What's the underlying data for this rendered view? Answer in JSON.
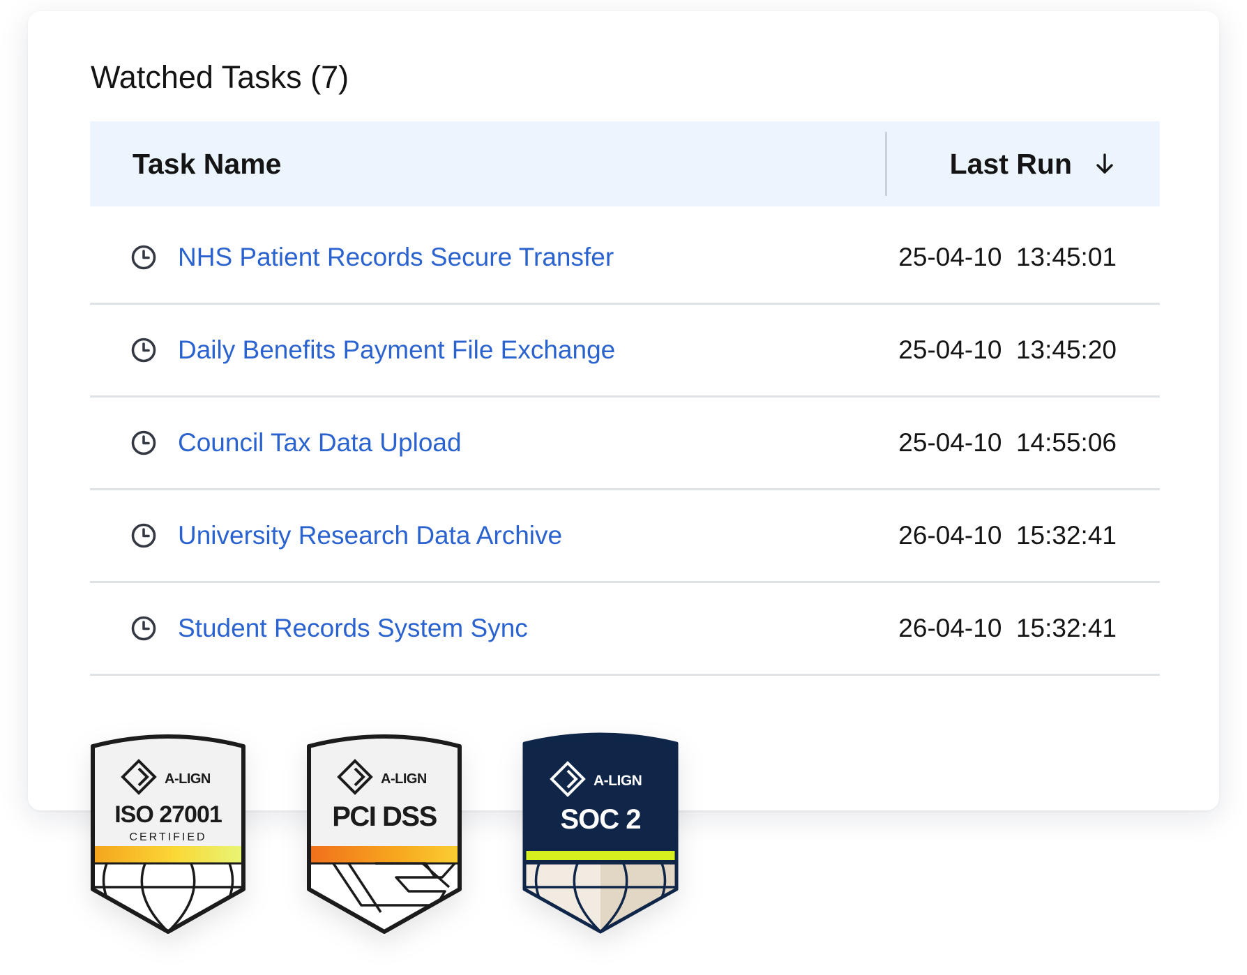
{
  "header": {
    "title": "Watched Tasks (7)"
  },
  "table": {
    "columns": {
      "task_name": "Task Name",
      "last_run": "Last Run"
    },
    "sort_icon": "arrow-down-icon",
    "row_icon": "clock-icon",
    "rows": [
      {
        "name": "NHS Patient Records Secure Transfer",
        "last_run": "25-04-10  13:45:01"
      },
      {
        "name": "Daily Benefits Payment File Exchange",
        "last_run": "25-04-10  13:45:20"
      },
      {
        "name": "Council Tax Data Upload",
        "last_run": "25-04-10  14:55:06"
      },
      {
        "name": "University Research Data Archive",
        "last_run": "26-04-10  15:32:41"
      },
      {
        "name": "Student Records System Sync",
        "last_run": "26-04-10  15:32:41"
      }
    ]
  },
  "badges": [
    {
      "brand": "A-LIGN",
      "title": "ISO 27001",
      "subtitle": "CERTIFIED"
    },
    {
      "brand": "A-LIGN",
      "title": "PCI DSS"
    },
    {
      "brand": "A-LIGN",
      "title": "SOC 2"
    }
  ],
  "colors": {
    "link": "#2a63cf",
    "header_bg": "#ecf4fe",
    "soc_navy": "#0f2649",
    "soc_stripe": "#d6ef1e"
  }
}
